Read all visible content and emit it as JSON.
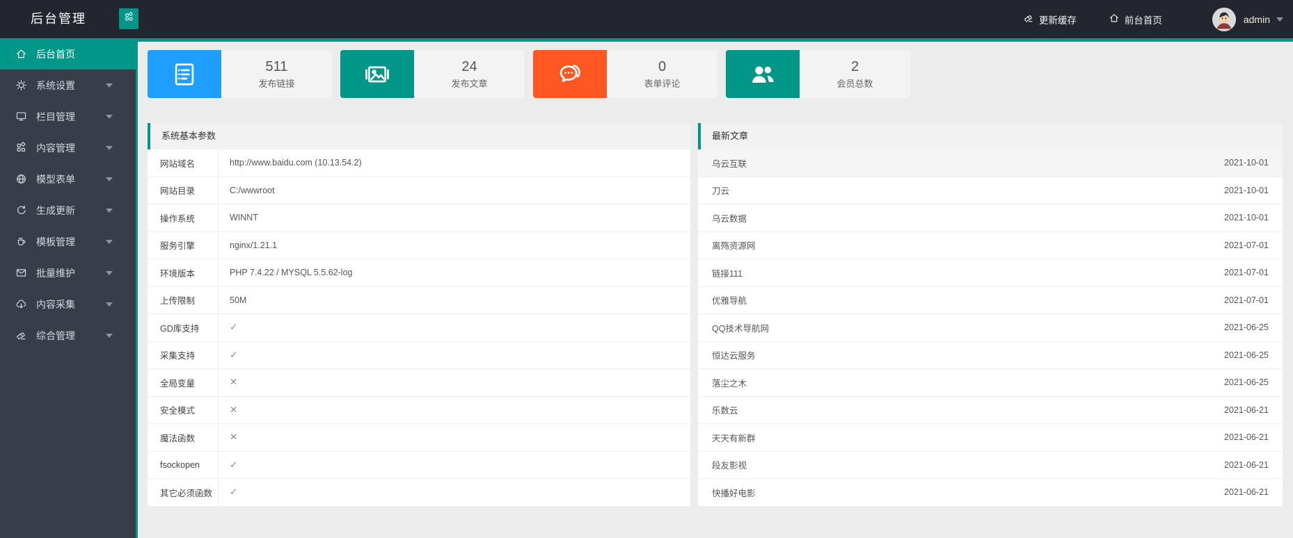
{
  "colors": {
    "accent": "#009688",
    "blue": "#1E9FFF",
    "orange": "#FF5722",
    "header_bg": "#23262e",
    "sidebar_bg": "#393d49"
  },
  "header": {
    "title": "后台管理",
    "collapse_icon": "grid-icon",
    "actions": [
      {
        "icon": "eraser-icon",
        "label": "更新缓存"
      },
      {
        "icon": "home-icon",
        "label": "前台首页"
      }
    ],
    "user": {
      "name": "admin",
      "avatar_icon": "avatar-cartoon"
    }
  },
  "sidebar": {
    "items": [
      {
        "icon": "home-icon",
        "label": "后台首页",
        "active": true,
        "caret": false
      },
      {
        "icon": "gear-icon",
        "label": "系统设置",
        "active": false,
        "caret": true
      },
      {
        "icon": "monitor-icon",
        "label": "栏目管理",
        "active": false,
        "caret": true
      },
      {
        "icon": "grid-icon",
        "label": "内容管理",
        "active": false,
        "caret": true
      },
      {
        "icon": "globe-icon",
        "label": "模型表单",
        "active": false,
        "caret": true
      },
      {
        "icon": "refresh-icon",
        "label": "生成更新",
        "active": false,
        "caret": true
      },
      {
        "icon": "cup-icon",
        "label": "模板管理",
        "active": false,
        "caret": true
      },
      {
        "icon": "mail-icon",
        "label": "批量维护",
        "active": false,
        "caret": true
      },
      {
        "icon": "cloud-upload-icon",
        "label": "内容采集",
        "active": false,
        "caret": true
      },
      {
        "icon": "eraser-icon",
        "label": "综合管理",
        "active": false,
        "caret": true
      }
    ]
  },
  "stats": [
    {
      "value": "511",
      "label": "发布链接",
      "icon": "form-icon",
      "color": "#1E9FFF"
    },
    {
      "value": "24",
      "label": "发布文章",
      "icon": "images-icon",
      "color": "#009688"
    },
    {
      "value": "0",
      "label": "表单评论",
      "icon": "chat-icon",
      "color": "#FF5722"
    },
    {
      "value": "2",
      "label": "会员总数",
      "icon": "users-icon",
      "color": "#009688"
    }
  ],
  "system_panel": {
    "title": "系统基本参数",
    "rows": [
      {
        "label": "网站域名",
        "value": "http://www.baidu.com (10.13.54.2)",
        "mark": false
      },
      {
        "label": "网站目录",
        "value": "C:/wwwroot",
        "mark": false
      },
      {
        "label": "操作系统",
        "value": "WINNT",
        "mark": false
      },
      {
        "label": "服务引擎",
        "value": "nginx/1.21.1",
        "mark": false
      },
      {
        "label": "环境版本",
        "value": "PHP 7.4.22 / MYSQL 5.5.62-log",
        "mark": false
      },
      {
        "label": "上传限制",
        "value": "50M",
        "mark": false
      },
      {
        "label": "GD库支持",
        "value": "✓",
        "mark": true
      },
      {
        "label": "采集支持",
        "value": "✓",
        "mark": true
      },
      {
        "label": "全局变量",
        "value": "✕",
        "mark": true
      },
      {
        "label": "安全模式",
        "value": "✕",
        "mark": true
      },
      {
        "label": "魔法函数",
        "value": "✕",
        "mark": true
      },
      {
        "label": "fsockopen",
        "value": "✓",
        "mark": true
      },
      {
        "label": "其它必须函数",
        "value": "✓",
        "mark": true
      }
    ]
  },
  "articles_panel": {
    "title": "最新文章",
    "rows": [
      {
        "title": "乌云互联",
        "date": "2021-10-01",
        "highlight": true
      },
      {
        "title": "刀云",
        "date": "2021-10-01",
        "highlight": false
      },
      {
        "title": "乌云数据",
        "date": "2021-10-01",
        "highlight": false
      },
      {
        "title": "离殇资源网",
        "date": "2021-07-01",
        "highlight": false
      },
      {
        "title": "链接111",
        "date": "2021-07-01",
        "highlight": false
      },
      {
        "title": "优雅导航",
        "date": "2021-07-01",
        "highlight": false
      },
      {
        "title": "QQ技术导航网",
        "date": "2021-06-25",
        "highlight": false
      },
      {
        "title": "恒达云服务",
        "date": "2021-06-25",
        "highlight": false
      },
      {
        "title": "落尘之木",
        "date": "2021-06-25",
        "highlight": false
      },
      {
        "title": "乐数云",
        "date": "2021-06-21",
        "highlight": false
      },
      {
        "title": "天天有新群",
        "date": "2021-06-21",
        "highlight": false
      },
      {
        "title": "段友影视",
        "date": "2021-06-21",
        "highlight": false
      },
      {
        "title": "快播好电影",
        "date": "2021-06-21",
        "highlight": false
      }
    ]
  }
}
